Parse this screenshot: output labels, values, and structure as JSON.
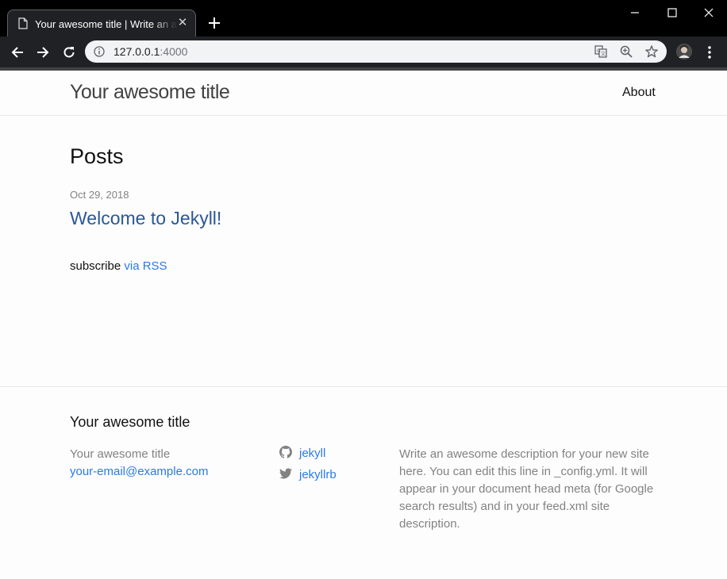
{
  "browser": {
    "tab_title": "Your awesome title | Write an awesome description",
    "url_host": "127.0.0.1",
    "url_port": ":4000",
    "colors": {
      "frame": "#000000",
      "toolbar": "#202124",
      "omnibox": "#f1f3f4"
    },
    "icons": [
      "page-icon",
      "close-icon",
      "plus-icon",
      "minimize-icon",
      "maximize-icon",
      "close-window-icon",
      "back-icon",
      "forward-icon",
      "reload-icon",
      "info-icon",
      "translate-icon",
      "zoom-icon",
      "star-icon",
      "avatar",
      "more-icon"
    ]
  },
  "site": {
    "title": "Your awesome title",
    "nav": {
      "about": "About"
    }
  },
  "main": {
    "heading": "Posts",
    "posts": [
      {
        "date": "Oct 29, 2018",
        "title": "Welcome to Jekyll!"
      }
    ],
    "subscribe_prefix": "subscribe",
    "subscribe_link": "via RSS"
  },
  "footer": {
    "heading": "Your awesome title",
    "name": "Your awesome title",
    "email": "your-email@example.com",
    "social": [
      {
        "icon": "github-icon",
        "label": "jekyll"
      },
      {
        "icon": "twitter-icon",
        "label": "jekyllrb"
      }
    ],
    "description": "Write an awesome description for your new site here. You can edit this line in _config.yml. It will appear in your document head meta (for Google search results) and in your feed.xml site description."
  },
  "colors": {
    "link": "#2a7ae2",
    "muted": "#828282",
    "text": "#111111",
    "border": "#e8e8e8"
  }
}
